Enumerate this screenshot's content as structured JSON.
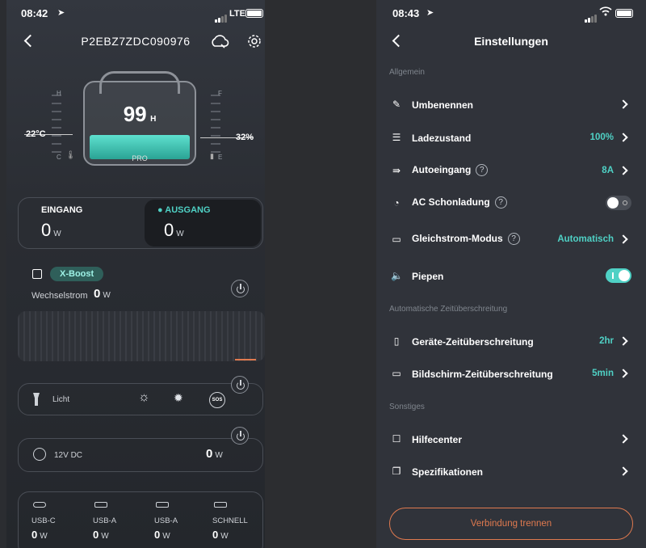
{
  "left": {
    "status": {
      "time": "08:42",
      "network": "LTE"
    },
    "header": {
      "title": "P2EBZ7ZDC090976"
    },
    "device": {
      "hours": "99",
      "hours_unit": "H",
      "model": "PRO",
      "temperature": "22°C",
      "charge": "32%",
      "gauge_left_top": "H",
      "gauge_left_bottom": "C",
      "gauge_right_top": "F",
      "gauge_right_bottom": "E",
      "charge_level": 0.32
    },
    "io": {
      "input_label": "EINGANG",
      "input_value": "0",
      "input_unit": "W",
      "output_label": "● AUSGANG",
      "output_value": "0",
      "output_unit": "W"
    },
    "ac": {
      "badge": "X-Boost",
      "label": "Wechselstrom",
      "value": "0",
      "unit": "W"
    },
    "light": {
      "label": "Licht",
      "sos": "SOS"
    },
    "dc": {
      "label": "12V DC",
      "value": "0",
      "unit": "W"
    },
    "usb": [
      {
        "label": "USB-C",
        "value": "0",
        "unit": "W"
      },
      {
        "label": "USB-A",
        "value": "0",
        "unit": "W"
      },
      {
        "label": "USB-A",
        "value": "0",
        "unit": "W"
      },
      {
        "label": "SCHNELL",
        "value": "0",
        "unit": "W"
      }
    ]
  },
  "right": {
    "status": {
      "time": "08:43"
    },
    "header": {
      "title": "Einstellungen"
    },
    "sections": {
      "general": "Allgemein",
      "timeout": "Automatische Zeitüberschreitung",
      "other": "Sonstiges"
    },
    "items": {
      "rename": "Umbenennen",
      "charge_level_label": "Ladezustand",
      "charge_level_value": "100%",
      "car_input_label": "Autoeingang",
      "car_input_value": "8A",
      "ac_gentle_label": "AC Schonladung",
      "dc_mode_label": "Gleichstrom-Modus",
      "dc_mode_value": "Automatisch",
      "beep_label": "Piepen",
      "device_timeout_label": "Geräte-Zeitüberschreitung",
      "device_timeout_value": "2hr",
      "screen_timeout_label": "Bildschirm-Zeitüberschreitung",
      "screen_timeout_value": "5min",
      "help_center": "Hilfecenter",
      "specs": "Spezifikationen"
    },
    "help_glyph": "?",
    "disconnect": "Verbindung trennen",
    "toggles": {
      "ac_gentle": false,
      "beep": true
    }
  },
  "colors": {
    "accent": "#4fd1c5",
    "danger": "#e07a4f",
    "background": "#2b2d31"
  }
}
